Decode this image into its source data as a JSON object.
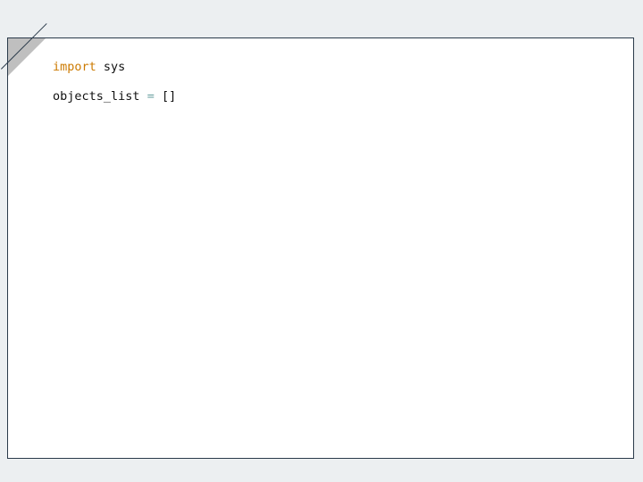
{
  "code": {
    "lines": [
      {
        "tokens": [
          {
            "kind": "keyword",
            "text": "import"
          },
          {
            "kind": "space",
            "text": " "
          },
          {
            "kind": "ident",
            "text": "sys"
          }
        ]
      },
      {
        "tokens": []
      },
      {
        "tokens": [
          {
            "kind": "ident",
            "text": "objects_list"
          },
          {
            "kind": "space",
            "text": " "
          },
          {
            "kind": "op",
            "text": "="
          },
          {
            "kind": "space",
            "text": " "
          },
          {
            "kind": "punct",
            "text": "[]"
          }
        ]
      }
    ]
  },
  "colors": {
    "background": "#eceff1",
    "card_bg": "#ffffff",
    "card_border": "#2a3a4a",
    "fold": "#bfbfbf",
    "keyword": "#cc7a00",
    "operator": "#6aa0a0",
    "text": "#111111"
  }
}
